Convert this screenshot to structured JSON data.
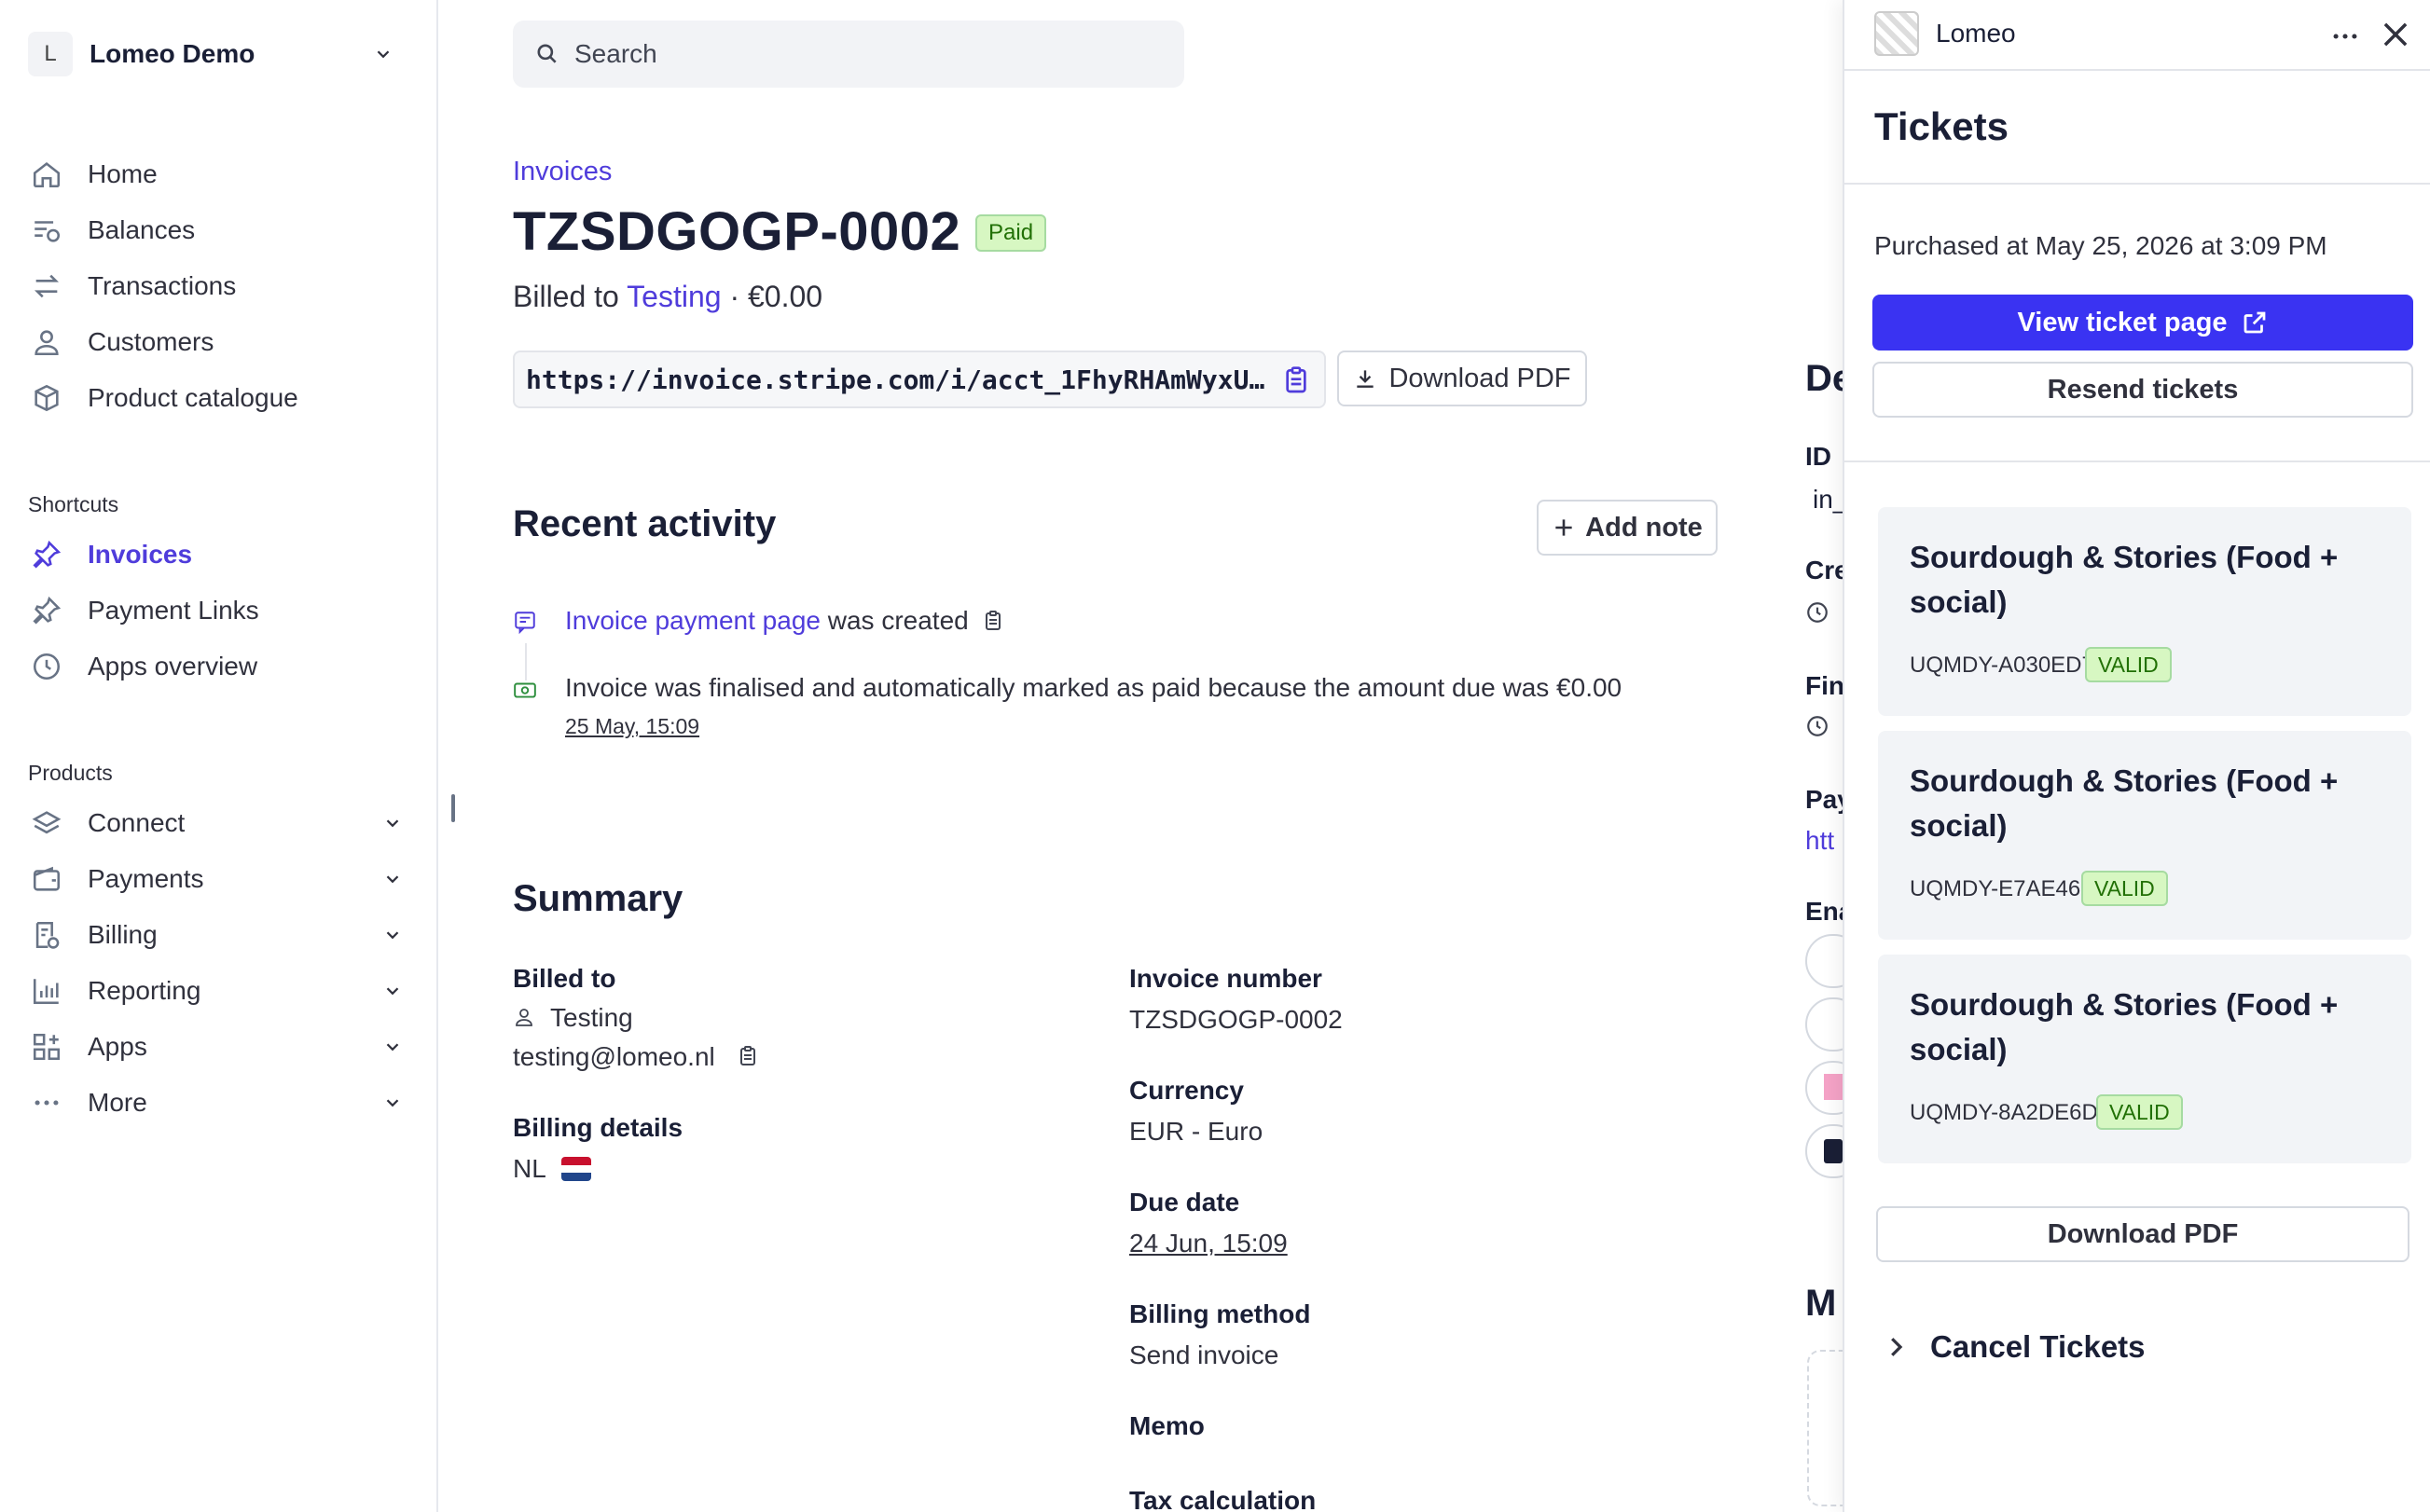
{
  "sidebar": {
    "account": {
      "initial": "L",
      "name": "Lomeo Demo"
    },
    "nav": [
      {
        "label": "Home",
        "icon": "home-icon"
      },
      {
        "label": "Balances",
        "icon": "balances-icon"
      },
      {
        "label": "Transactions",
        "icon": "transactions-icon"
      },
      {
        "label": "Customers",
        "icon": "customers-icon"
      },
      {
        "label": "Product catalogue",
        "icon": "box-icon"
      }
    ],
    "shortcuts_heading": "Shortcuts",
    "shortcuts": [
      {
        "label": "Invoices",
        "icon": "pin-icon",
        "active": true
      },
      {
        "label": "Payment Links",
        "icon": "pin-icon"
      },
      {
        "label": "Apps overview",
        "icon": "clock-icon"
      }
    ],
    "products_heading": "Products",
    "products": [
      {
        "label": "Connect",
        "icon": "connect-icon"
      },
      {
        "label": "Payments",
        "icon": "wallet-icon"
      },
      {
        "label": "Billing",
        "icon": "billing-icon"
      },
      {
        "label": "Reporting",
        "icon": "chart-icon"
      },
      {
        "label": "Apps",
        "icon": "apps-icon"
      },
      {
        "label": "More",
        "icon": "more-icon"
      }
    ]
  },
  "search": {
    "placeholder": "Search"
  },
  "invoice": {
    "breadcrumb": "Invoices",
    "number": "TZSDGOGP-0002",
    "status": "Paid",
    "billed_prefix": "Billed to ",
    "billed_name": "Testing",
    "billed_suffix": " · €0.00",
    "url": "https://invoice.stripe.com/i/acct_1FhyRHAmWyxU…",
    "download_label": "Download PDF"
  },
  "activity": {
    "heading": "Recent activity",
    "add_note": "Add note",
    "item1_link": "Invoice payment page",
    "item1_text": " was created",
    "item2_text": "Invoice was finalised and automatically marked as paid because the amount due was €0.00",
    "item2_time": "25 May, 15:09"
  },
  "summary": {
    "heading": "Summary",
    "billed_to_label": "Billed to",
    "billed_to_name": "Testing",
    "billed_to_email": "testing@lomeo.nl",
    "billing_details_label": "Billing details",
    "billing_details_country": "NL",
    "invoice_number_label": "Invoice number",
    "invoice_number": "TZSDGOGP-0002",
    "currency_label": "Currency",
    "currency": "EUR - Euro",
    "due_date_label": "Due date",
    "due_date": "24 Jun, 15:09",
    "billing_method_label": "Billing method",
    "billing_method": "Send invoice",
    "memo_label": "Memo",
    "tax_label": "Tax calculation"
  },
  "details_peek": {
    "heading": "De",
    "id_label": "ID",
    "id_value": "in_",
    "created": "Cre",
    "finalised": "Fin",
    "payment": "Pay",
    "payment_link": "htt",
    "enabled": "Ena",
    "more": "M"
  },
  "panel": {
    "app_name": "Lomeo",
    "title": "Tickets",
    "purchased": "Purchased at May 25, 2026 at 3:09 PM",
    "view_ticket": "View ticket page",
    "resend": "Resend tickets",
    "tickets": [
      {
        "name": "Sourdough & Stories (Food + social)",
        "code": "UQMDY-A030ED7",
        "status": "VALID"
      },
      {
        "name": "Sourdough & Stories (Food + social)",
        "code": "UQMDY-E7AE465",
        "status": "VALID"
      },
      {
        "name": "Sourdough & Stories (Food + social)",
        "code": "UQMDY-8A2DE6D",
        "status": "VALID"
      }
    ],
    "download_pdf": "Download PDF",
    "cancel_tickets": "Cancel Tickets"
  },
  "colors": {
    "accent": "#4f3cdb",
    "primary_button": "#3a33f2",
    "valid_bg": "#d7f7c2",
    "valid_text": "#217005"
  }
}
